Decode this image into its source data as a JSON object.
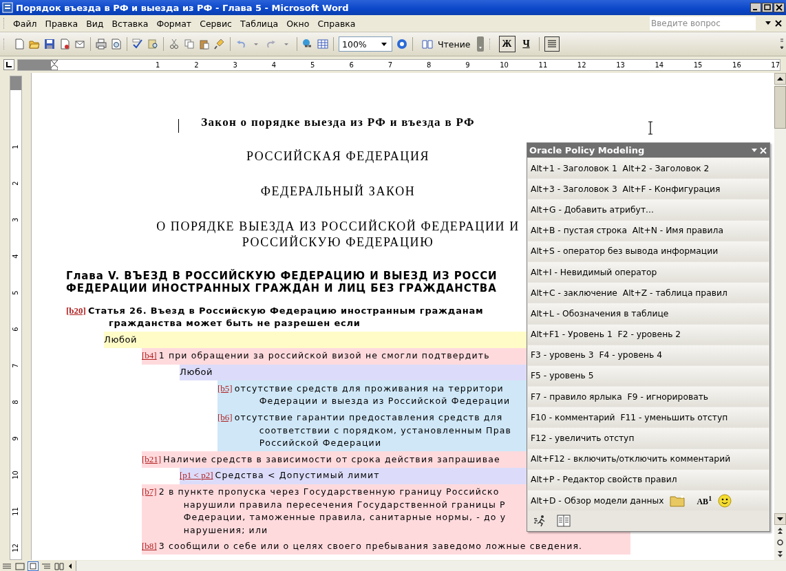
{
  "window": {
    "title": "Порядок въезда в РФ и выезда из РФ - Глава 5 - Microsoft Word"
  },
  "menu": [
    "Файл",
    "Правка",
    "Вид",
    "Вставка",
    "Формат",
    "Сервис",
    "Таблица",
    "Окно",
    "Справка"
  ],
  "help_search": {
    "placeholder": "Введите вопрос"
  },
  "toolbar": {
    "zoom": "100%",
    "reading": "Чтение",
    "bold": "Ж",
    "underline": "Ч"
  },
  "ruler": {
    "horizontal": [
      "1",
      "2",
      "3",
      "4",
      "5",
      "6",
      "7",
      "8",
      "9",
      "10",
      "11",
      "12",
      "13",
      "14",
      "15",
      "16",
      "17"
    ],
    "vertical": [
      "1",
      "2",
      "3",
      "4",
      "5",
      "6",
      "7",
      "8",
      "9",
      "10",
      "11",
      "12"
    ]
  },
  "document": {
    "headings": [
      {
        "kind": "title",
        "lines": [
          "Закон о порядке выезда из РФ и въезда в РФ"
        ]
      },
      {
        "kind": "heading",
        "lines": [
          "РОССИЙСКАЯ ФЕДЕРАЦИЯ"
        ]
      },
      {
        "kind": "heading",
        "lines": [
          "ФЕДЕРАЛЬНЫЙ ЗАКОН"
        ]
      },
      {
        "kind": "heading",
        "lines": [
          "О ПОРЯДКЕ ВЫЕЗДА ИЗ РОССИЙСКОЙ ФЕДЕРАЦИИ И",
          "РОССИЙСКУЮ ФЕДЕРАЦИЮ"
        ]
      },
      {
        "kind": "chapter",
        "lines": [
          "Глава V. ВЪЕЗД В РОССИЙСКУЮ ФЕДЕРАЦИЮ И ВЫЕЗД ИЗ РОССИ",
          "ФЕДЕРАЦИИ ИНОСТРАННЫХ ГРАЖДАН И ЛИЦ БЕЗ ГРАЖДАНСТВА"
        ]
      }
    ],
    "rules": [
      {
        "kind": "article",
        "tag": "[b20]",
        "lines": [
          "Статья 26. Въезд в Российскую Федерацию иностранным гражданам",
          "гражданства может быть не разрешен если"
        ],
        "children": [
          {
            "kind": "operator",
            "color": "#fffcc8",
            "lines": [
              "Любой"
            ],
            "children": [
              {
                "kind": "rule",
                "tag": "[b4]",
                "color": "#ffdadd",
                "lines": [
                  "1 при обращении за российской визой не смогли подтвердить"
                ],
                "children": [
                  {
                    "kind": "operator",
                    "color": "#dcdcfa",
                    "lines": [
                      "Любой"
                    ],
                    "children": [
                      {
                        "kind": "rule",
                        "tag": "[b5]",
                        "color": "#cfe7f7",
                        "lines": [
                          "отсутствие средств для проживания на территори",
                          "Федерации и выезда из Российской Федерации"
                        ]
                      },
                      {
                        "kind": "rule",
                        "tag": "[b6]",
                        "color": "#cfe7f7",
                        "lines": [
                          "отсутствие гарантии предоставления средств для",
                          "соответствии с порядком, установленным Прав",
                          "Российской Федерации"
                        ]
                      }
                    ]
                  }
                ]
              },
              {
                "kind": "rule",
                "tag": "[b21]",
                "color": "#ffdadd",
                "lines": [
                  "Наличие средств в зависимости от срока действия запрашивае"
                ],
                "children": [
                  {
                    "kind": "rule",
                    "tag": "[p1 < p2]",
                    "color": "#dcdcfa",
                    "lines": [
                      "Средства < Допустимый лимит"
                    ]
                  }
                ]
              },
              {
                "kind": "rule",
                "tag": "[b7]",
                "color": "#ffdadd",
                "lines": [
                  "2 в пункте пропуска через Государственную границу Российско",
                  "нарушили правила пересечения Государственной границы Р",
                  "Федерации, таможенные правила, санитарные нормы, - до у",
                  "нарушения; или"
                ]
              },
              {
                "kind": "rule",
                "tag": "[b8]",
                "color": "#ffdadd",
                "lines": [
                  "3 сообщили о себе или о целях своего пребывания заведомо ложные сведения."
                ]
              }
            ]
          }
        ]
      }
    ]
  },
  "panel": {
    "title": "Oracle Policy Modeling",
    "rows": [
      "Alt+1 - Заголовок 1  Alt+2 - Заголовок 2",
      "Alt+3 - Заголовок 3  Alt+F - Конфигурация",
      "Alt+G - Добавить атрибут...",
      "Alt+B - пустая строка  Alt+N - Имя правила",
      "Alt+S - оператор без вывода информации",
      "Alt+I - Невидимый оператор",
      "Alt+C - заключение  Alt+Z - таблица правил",
      "Alt+L - Обозначения в таблице",
      "Alt+F1 - Уровень 1  F2 - уровень 2",
      "F3 - уровень 3  F4 - уровень 4",
      "F5 - уровень 5",
      "F7 - правило ярлыка  F9 - игнорировать",
      "F10 - комментарий  F11 - уменьшить отступ",
      "F12 - увеличить отступ",
      "Alt+F12 - включить/отключить комментарий",
      "Alt+P - Редактор свойств правил",
      "Alt+D - Обзор модели данных"
    ],
    "superscript_button": "AB$^{1}$"
  }
}
